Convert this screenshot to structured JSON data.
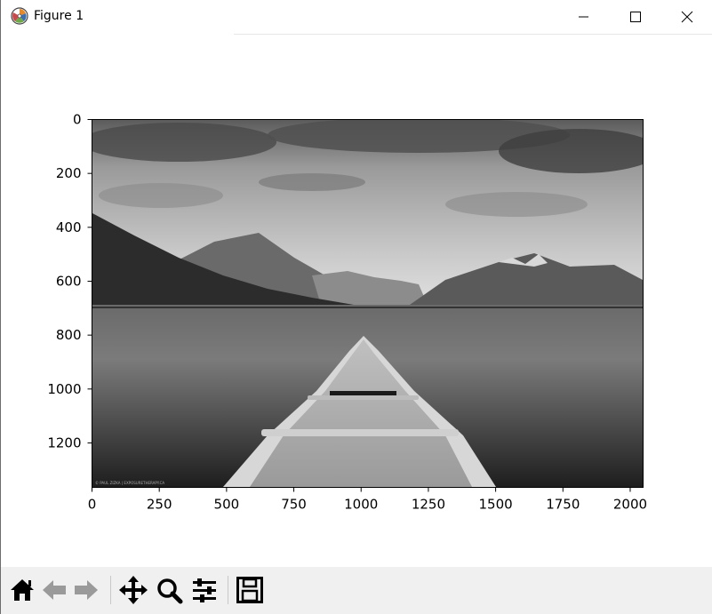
{
  "window": {
    "title": "Figure 1",
    "app_icon": "matplotlib-logo-icon"
  },
  "window_controls": [
    "minimize-icon",
    "maximize-icon",
    "close-icon"
  ],
  "plot": {
    "type": "image",
    "image_description_colors": {
      "frame": "#000000",
      "background": "#ffffff"
    },
    "x_ticks": [
      "0",
      "250",
      "500",
      "750",
      "1000",
      "1250",
      "1500",
      "1750",
      "2000"
    ],
    "y_ticks": [
      "0",
      "200",
      "400",
      "600",
      "800",
      "1000",
      "1200"
    ],
    "xlim": [
      0,
      2048
    ],
    "ylim": [
      1365,
      0
    ]
  },
  "toolbar": {
    "buttons": [
      "home-icon",
      "back-icon",
      "forward-icon",
      "pan-icon",
      "zoom-icon",
      "configure-subplots-icon",
      "save-icon"
    ]
  }
}
